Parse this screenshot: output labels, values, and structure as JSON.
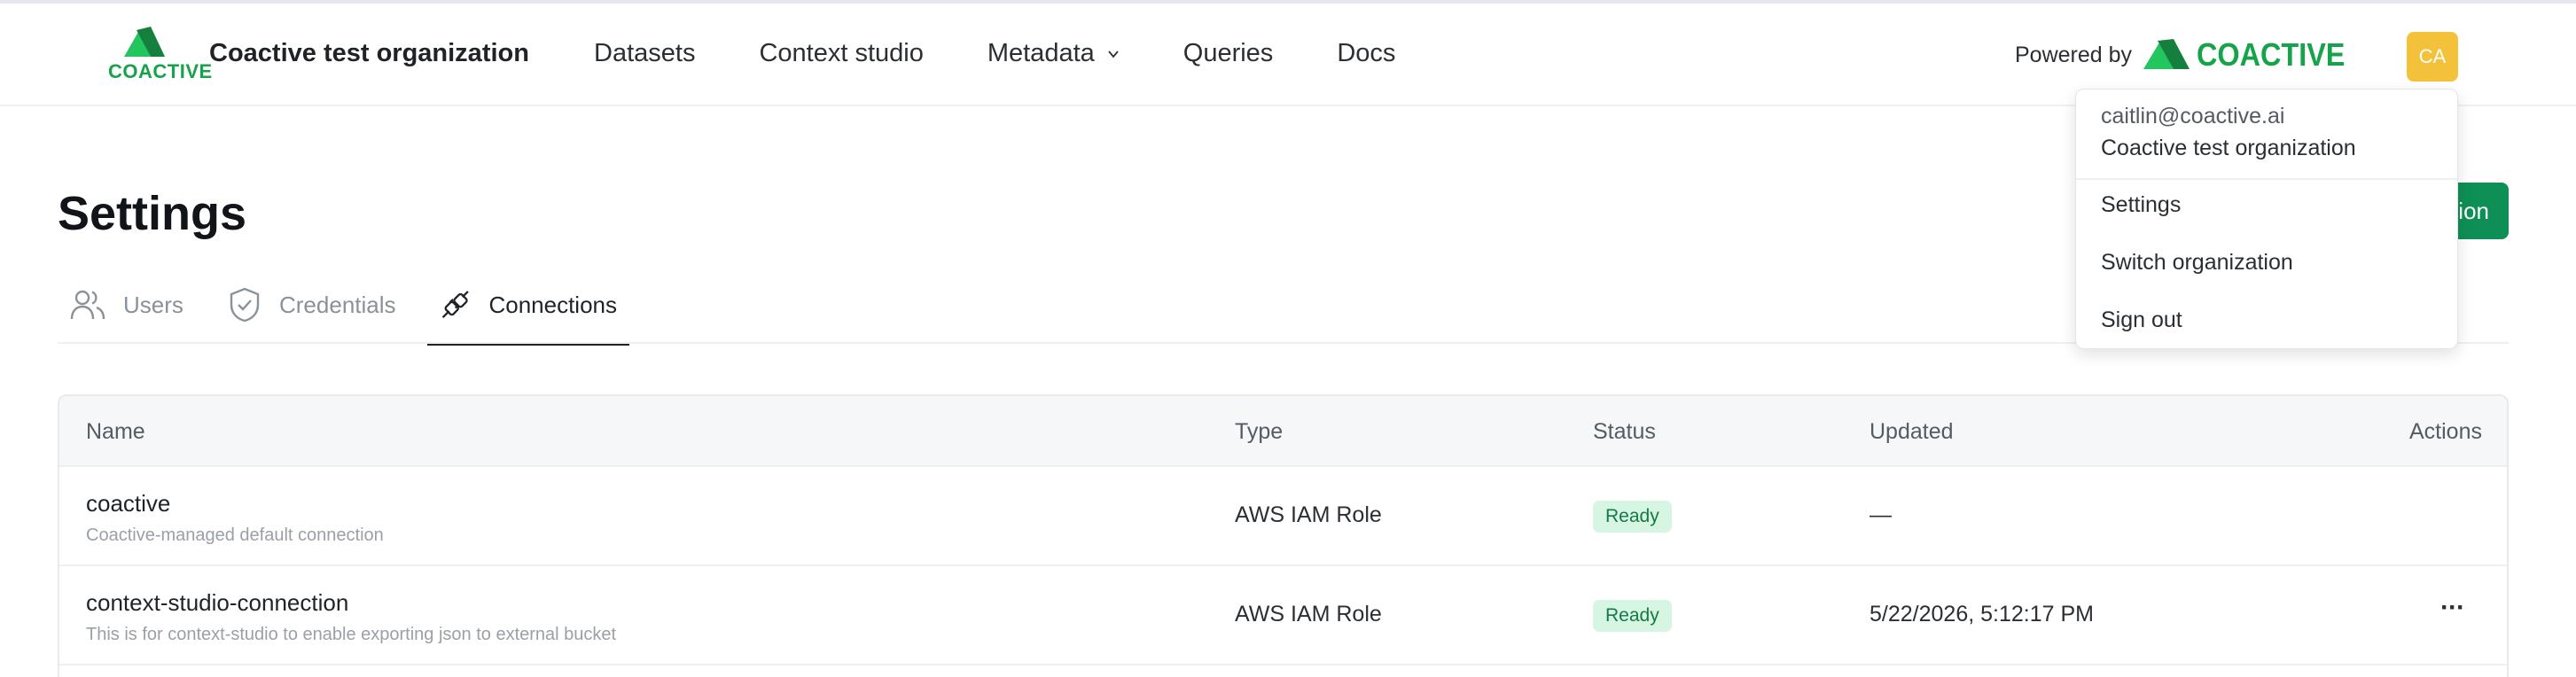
{
  "header": {
    "brand_wordmark": "COACTIVE",
    "org_name": "Coactive test organization",
    "nav": [
      {
        "label": "Datasets"
      },
      {
        "label": "Context studio"
      },
      {
        "label": "Metadata"
      },
      {
        "label": "Queries"
      },
      {
        "label": "Docs"
      }
    ],
    "powered_by": "Powered by",
    "powered_logo_text": "COACTIVE",
    "avatar_initials": "CA",
    "colors": {
      "brand_green": "#16a34a",
      "avatar_bg": "#f3c13a"
    }
  },
  "page": {
    "title": "Settings",
    "primary_button_label": "ion",
    "tabs": [
      {
        "label": "Users",
        "icon": "users-icon"
      },
      {
        "label": "Credentials",
        "icon": "shield-check-icon"
      },
      {
        "label": "Connections",
        "icon": "plug-icon",
        "active": true
      }
    ]
  },
  "table": {
    "columns": [
      "Name",
      "Type",
      "Status",
      "Updated",
      "Actions"
    ],
    "rows": [
      {
        "name": "coactive",
        "description": "Coactive-managed default connection",
        "type": "AWS IAM Role",
        "status": "Ready",
        "updated": "—"
      },
      {
        "name": "context-studio-connection",
        "description": "This is for context-studio to enable exporting json to external bucket",
        "type": "AWS IAM Role",
        "status": "Ready",
        "updated": "5/22/2026, 5:12:17 PM",
        "actions_icon": "more-horizontal-icon",
        "actions_text": "···"
      }
    ]
  },
  "user_menu": {
    "email": "caitlin@coactive.ai",
    "org": "Coactive test organization",
    "items": [
      {
        "label": "Settings"
      },
      {
        "label": "Switch organization"
      },
      {
        "label": "Sign out"
      }
    ]
  }
}
